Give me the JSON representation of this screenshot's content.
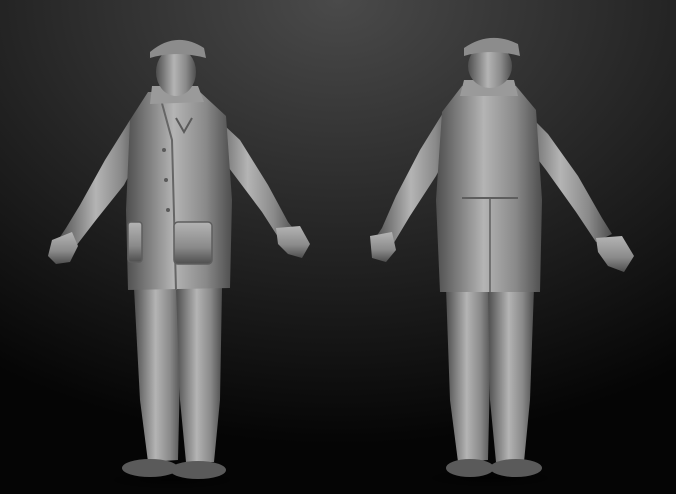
{
  "scene": {
    "background": {
      "top": "#4a4a4a",
      "bottom": "#050505"
    },
    "material": {
      "light": "#b4b4b4",
      "mid": "#8a8a8a",
      "dark": "#4e4e4e"
    },
    "figures": [
      {
        "view": "front",
        "icon": "sculpt-figure-front"
      },
      {
        "view": "back",
        "icon": "sculpt-figure-back"
      }
    ]
  }
}
